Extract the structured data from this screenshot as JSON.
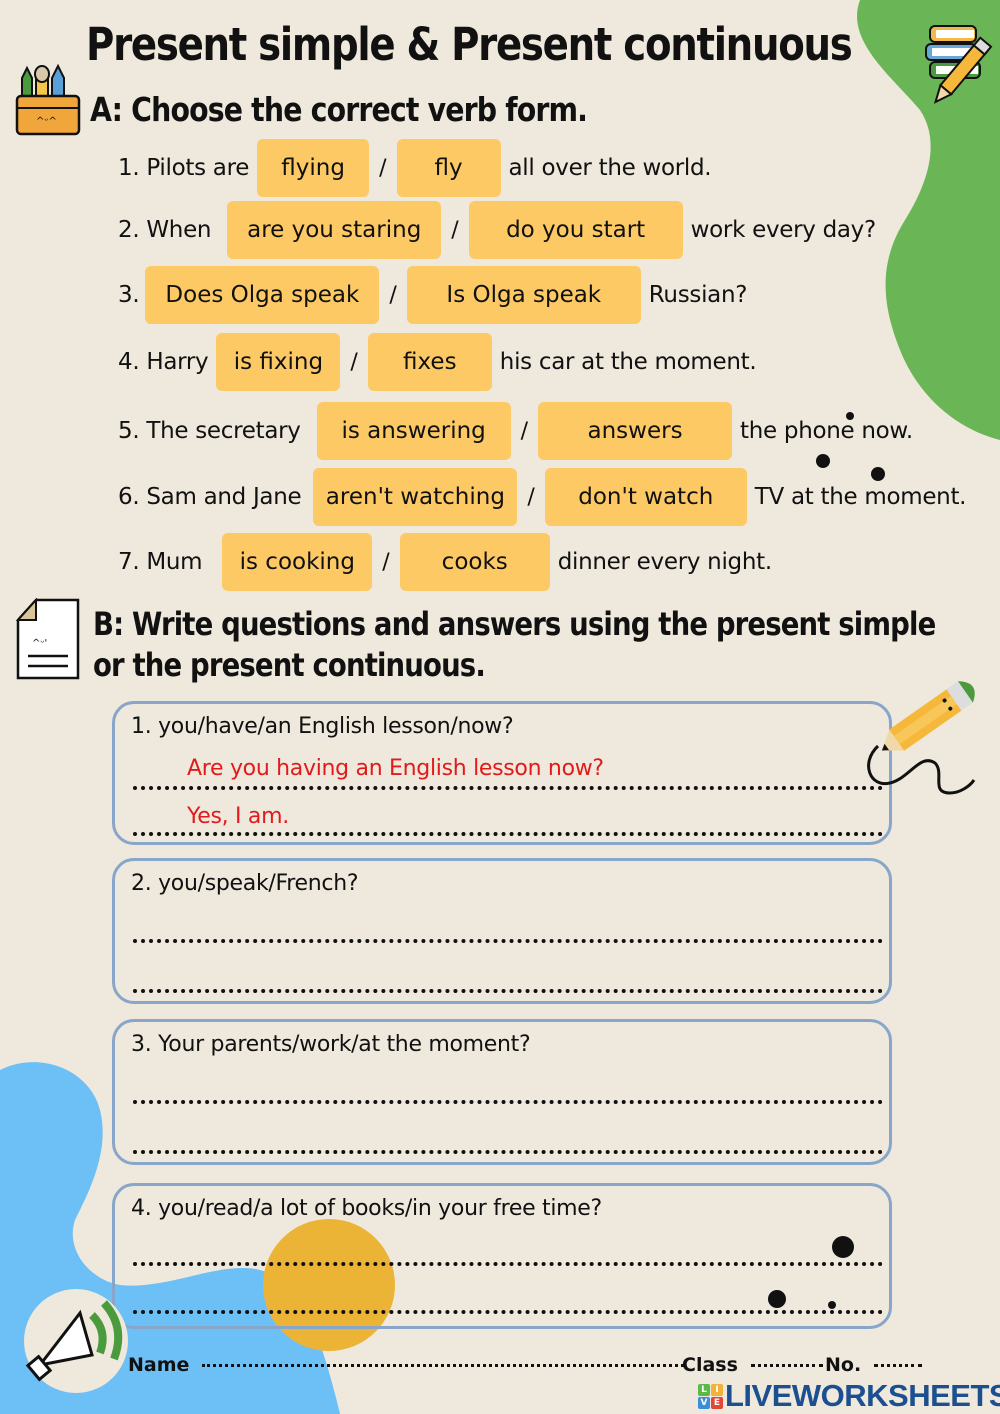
{
  "title": "Present simple & Present continuous",
  "section_a": {
    "heading": "A: Choose the correct verb form.",
    "questions": [
      {
        "before": "1. Pilots are",
        "option1": "flying",
        "option2": "fly",
        "after": "all over the world."
      },
      {
        "before": "2. When",
        "option1": "are you staring",
        "option2": "do you start",
        "after": "work every day?"
      },
      {
        "before": "3.",
        "option1": "Does Olga speak",
        "option2": "Is Olga speak",
        "after": "Russian?"
      },
      {
        "before": "4. Harry",
        "option1": "is fixing",
        "option2": "fixes",
        "after": "his car at the moment."
      },
      {
        "before": "5. The secretary",
        "option1": "is answering",
        "option2": "answers",
        "after": "the phone now."
      },
      {
        "before": "6. Sam and Jane",
        "option1": "aren't watching",
        "option2": "don't watch",
        "after": "TV at the moment."
      },
      {
        "before": "7. Mum",
        "option1": "is cooking",
        "option2": "cooks",
        "after": "dinner every night."
      }
    ],
    "separator": "/"
  },
  "section_b": {
    "heading_line1": "B: Write questions and answers using the present simple",
    "heading_line2": "or the present continuous.",
    "items": [
      {
        "prompt": "1. you/have/an English lesson/now?",
        "answer1": "Are you having an English lesson now?",
        "answer2": "Yes, I am."
      },
      {
        "prompt": "2. you/speak/French?",
        "answer1": "",
        "answer2": ""
      },
      {
        "prompt": "3. Your parents/work/at the moment?",
        "answer1": "",
        "answer2": ""
      },
      {
        "prompt": "4. you/read/a lot of books/in your free time?",
        "answer1": "",
        "answer2": ""
      }
    ]
  },
  "footer": {
    "name_label": "Name",
    "class_label": "Class",
    "no_label": "No.",
    "brand": "LIVEWORKSHEETS",
    "brand_letters": [
      "L",
      "I",
      "V",
      "E"
    ]
  },
  "colors": {
    "background": "#efe8dc",
    "option_fill": "#fdc965",
    "answer_red": "#e11b1b",
    "box_border": "#88a6c9",
    "blob_green": "#6ab556",
    "blob_blue": "#6cc0f5",
    "circle_yellow": "#ebb437",
    "brand_blue": "#1b4f8f"
  }
}
